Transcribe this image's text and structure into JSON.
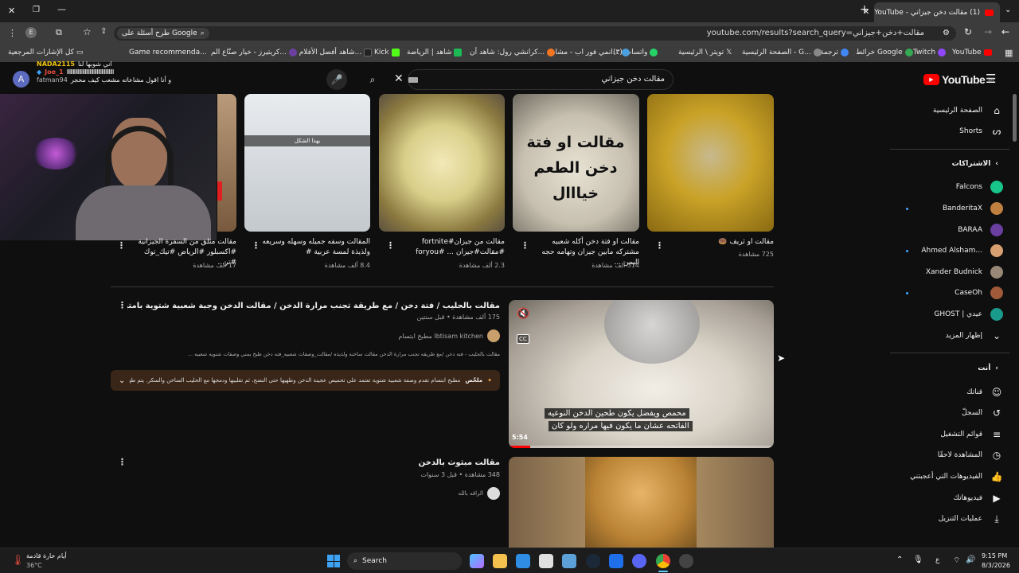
{
  "browser": {
    "tab_title": "(1) مقالت دخن جيزاني - YouTube",
    "url": "youtube.com/results?search_query=مقالت+دخن+جيزاني",
    "ask_google": "طرح أسئلة على Google",
    "bookmarks": [
      "YouTube",
      "Twitch",
      "خرائط Google",
      "ترجمة",
      "الصفحة الرئيسية - G...",
      "تويتر \\ الرئيسية",
      "(٣) واتساب",
      "انمي فور اب - مشاهد...",
      "كرانشي رول: شاهد أن...",
      "شاهد | الرياضة",
      "Kick",
      "شاهد أفضل الأفلام وا...",
      "كريتيرز - خيار صنّاع الم...",
      "Game recommenda...",
      "كل الإشارات المرجعية"
    ]
  },
  "stream_overlay": {
    "user1": "NADA2115",
    "msg1": "اني شوبها لنا",
    "user2": "Joe_1",
    "msg2": "و أنا اقول مشاعاته مشعب كيف محجر",
    "user3": "fatman94"
  },
  "youtube": {
    "logo": "YouTube",
    "region": "SA",
    "search_value": "مقالت دخن جيزاني",
    "account_initial": "A",
    "shorts": [
      {
        "title": "مقالت او ثريف 🍩",
        "views": "725 مشاهدة",
        "caption": ""
      },
      {
        "title": "مقالت او فتة دخن أكله شعبيه مشتركه مابين جيزان وتهامه حجه اليمن ...",
        "views": "314 ألف مشاهدة",
        "caption": "مقالت او فتة دخن الطعم خيااال"
      },
      {
        "title": "مقالت من جيزان#fortnite #مقالت#جيزان ... #foryou",
        "views": "2.3 ألف مشاهدة",
        "caption": ""
      },
      {
        "title": "المقالت وسفه جميله وسهله وسريعه ولذيذة لمسة عربية #",
        "views": "8.4 ألف مشاهدة",
        "caption": "بهذا الشكل"
      },
      {
        "title": "مقالت مثلق من السفرة الجيزانية #اكسبلور #الرياض #تيك_توك #تر...",
        "views": "17 ألف مشاهدة",
        "caption": ""
      }
    ],
    "videos": [
      {
        "title": "مقالت بالحليب / فتة دخن / مع طريقة تجنب مرارة الدخن / مقالت الدخن وجبة شعبية شتوية بامتياز",
        "meta": "175 ألف مشاهدة • قبل سنتين",
        "channel": "مطبخ ابتسام Ibtisam kitchen",
        "desc": "مقالت بالحليب - فته دخن /مع طريقه تجنب مرارة الدخن مقالت ساخنه ولذيذه /مقالت_وصفات شعبيه_فته دخن طبخ يمني وصفات شتويه شعبيه ...",
        "summary_label": "ملخّص",
        "summary": "مطبخ ابتسام تقدم وصفة شعبية شتوية تعتمد على تحميص عجينة الدخن وطهيها حتى النضج، ثم تقليبها ودمجها مع الحليب الساخن والسكر. يتم طهي الخليط ببطء حتى...",
        "duration": "5:54",
        "cc": "CC",
        "subtitle1": "محمص ويفضل يكون طحين الدخن النوعيه",
        "subtitle2": "الفاتحه عشان ما يكون فيها مراره ولو كان"
      },
      {
        "title": "مقالت مبثوث بالدخن",
        "meta": "348 مشاهدة • قبل 3 سنوات",
        "channel": "الراقه بالله"
      }
    ],
    "sidebar": {
      "home": "الصفحة الرئيسية",
      "shorts": "Shorts",
      "subscriptions": "الاشتراكات",
      "subs": [
        "Falcons",
        "BanderitaX",
        "BARAA",
        "Ahmed Alsham...",
        "Xander Budnick",
        "CaseOh",
        "GHOST | عيدي"
      ],
      "show_more": "إظهار المزيد",
      "you": "أنت",
      "you_items": [
        "قناتك",
        "السجلّ",
        "قوائم التشغيل",
        "المشاهدة لاحقًا",
        "الفيديوهات التي أعجبتني",
        "فيديوهاتك",
        "عمليات التنزيل"
      ]
    }
  },
  "taskbar": {
    "weather_title": "أيام حارة قادمة",
    "weather_temp": "36°C",
    "search": "Search",
    "time": "9:15 PM",
    "date": "8/3/2026",
    "lang": "ع"
  },
  "colors": {
    "youtube_red": "#ff0000",
    "summary_bg": "#3a2618",
    "progress": "#ff0000"
  }
}
